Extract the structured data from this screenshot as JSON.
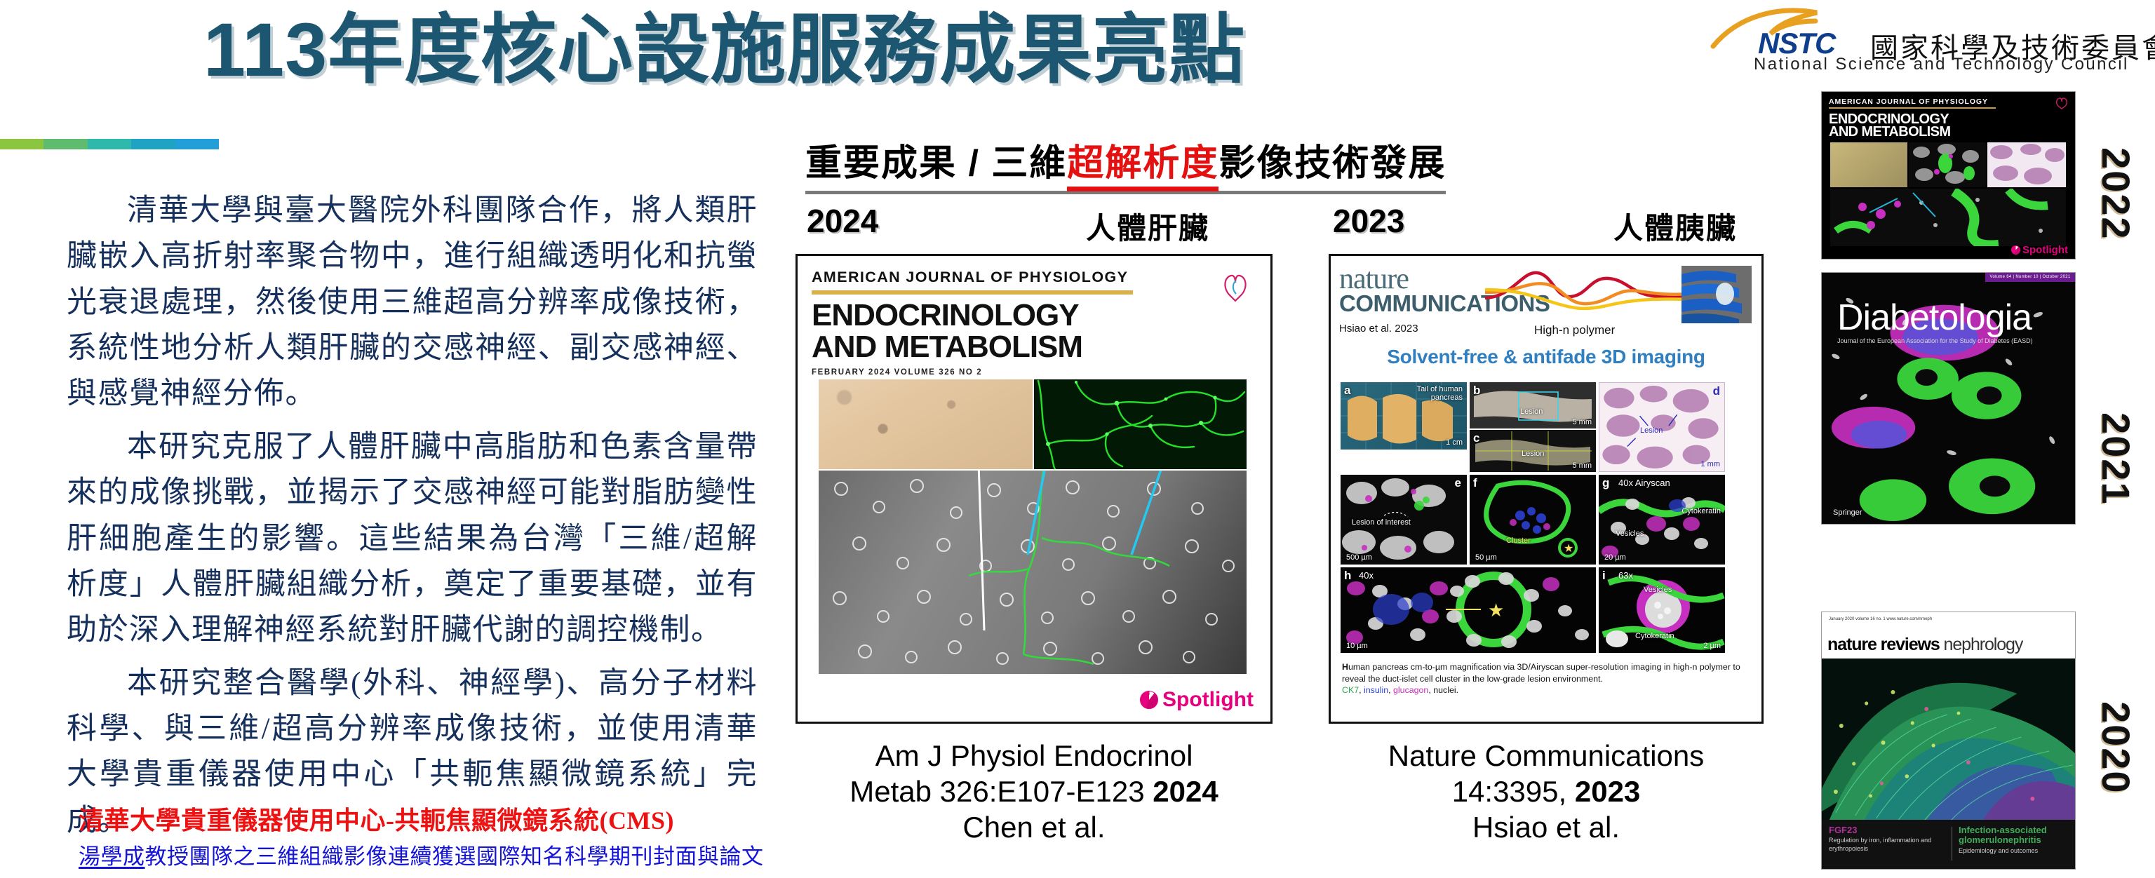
{
  "slide": {
    "title": "113年度核心設施服務成果亮點",
    "title_color": "#1d5670",
    "accent_bar_colors": [
      "#8CC63F",
      "#5FBC6E",
      "#2FB9AD",
      "#1FA3C4",
      "#229FD8"
    ]
  },
  "logo": {
    "acronym": "NSTC",
    "name_cn": "國家科學及技術委員會",
    "name_en": "National Science and Technology Council",
    "swoosh_color": "#E8A020",
    "acronym_color": "#0F3E8C"
  },
  "body": {
    "paragraphs": [
      "清華大學與臺大醫院外科團隊合作，將人類肝臟嵌入高折射率聚合物中，進行組織透明化和抗螢光衰退處理，然後使用三維超高分辨率成像技術，系統性地分析人類肝臟的交感神經、副交感神經、與感覺神經分佈。",
      "本研究克服了人體肝臟中高脂肪和色素含量帶來的成像挑戰，並揭示了交感神經可能對脂肪變性肝細胞產生的影響。這些結果為台灣「三維/超解析度」人體肝臟組織分析，奠定了重要基礎，並有助於深入理解神經系統對肝臟代謝的調控機制。",
      "本研究整合醫學(外科、神經學)、高分子材料科學、與三維/超高分辨率成像技術，並使用清華大學貴重儀器使用中心「共軛焦顯微鏡系統」完成。"
    ],
    "text_color": "#15305C"
  },
  "credits": {
    "line_red": "清華大學貴重儀器使用中心-共軛焦顯微鏡系統(CMS)",
    "line_red_color": "#EE1111",
    "line_blue_underlined": "湯學成",
    "line_blue_rest": "教授團隊之三維組織影像連續獲選國際知名科學期刊封面與論文",
    "line_blue_color": "#1414D8"
  },
  "section": {
    "header_pre": "重要成果 / 三維",
    "header_highlight": "超解析度",
    "header_post": "影像技術發展",
    "highlight_color": "#E41111"
  },
  "highlights": [
    {
      "year": "2024",
      "organ": "人體肝臟",
      "citation_line1": "Am J Physiol Endocrinol",
      "citation_line2_pre": "Metab 326:E107-E123 ",
      "citation_line2_bold": "2024",
      "citation_line3": "Chen et al."
    },
    {
      "year": "2023",
      "organ": "人體胰臟",
      "citation_line1": "Nature Communications",
      "citation_line2_pre": "14:3395, ",
      "citation_line2_bold": "2023",
      "citation_line3": "Hsiao et al."
    }
  ],
  "cover_ajp": {
    "kicker": "AMERICAN JOURNAL OF PHYSIOLOGY",
    "title_line1": "ENDOCRINOLOGY",
    "title_line2": "AND METABOLISM",
    "issue": "FEBRUARY 2024     VOLUME 326     NO 2",
    "badge": "Spotlight",
    "rule_color": "#D8B14A",
    "badge_color": "#E6007E"
  },
  "cover_natcom": {
    "brand_line1": "nature",
    "brand_line2": "COMMUNICATIONS",
    "author_note": "Hsiao et al. 2023",
    "polymer_label": "High-n polymer",
    "tagline": "Solvent-free & antifade 3D imaging",
    "panels": [
      {
        "tag": "a",
        "note": "Tail of human pancreas",
        "scale": "1 cm"
      },
      {
        "tag": "b",
        "note": "Lesion",
        "scale": "5 mm"
      },
      {
        "tag": "c",
        "note": "Lesion",
        "scale": "5 mm"
      },
      {
        "tag": "d",
        "note": "Lesion",
        "scale": "1 mm"
      },
      {
        "tag": "e",
        "note": "Lesion of interest",
        "scale": "500 µm"
      },
      {
        "tag": "f",
        "note": "Cluster",
        "scale": "50 µm"
      },
      {
        "tag": "g",
        "note": "40x Airyscan",
        "scale": "20 µm"
      },
      {
        "tag": "h",
        "note": "40x",
        "scale": "10 µm"
      },
      {
        "tag": "i",
        "note": "63x",
        "scale": "2 µm"
      }
    ],
    "panel_g_labels": [
      "Cytokeratin",
      "Vesicles"
    ],
    "panel_i_labels": [
      "Vesicles",
      "Cytokeratin"
    ],
    "caption_bold": "H",
    "caption_main": "uman pancreas cm-to-µm magnification via 3D/Airyscan super-resolution imaging in high-n polymer to reveal the duct-islet cell cluster in the low-grade lesion environment.",
    "caption_ck7": "CK7",
    "caption_insulin": "insulin",
    "caption_glucagon": "glucagon",
    "caption_nuclei": "nuclei."
  },
  "rail": [
    {
      "year": "2022",
      "journal_kicker": "AMERICAN JOURNAL OF PHYSIOLOGY",
      "journal_title_1": "ENDOCRINOLOGY",
      "journal_title_2": "AND METABOLISM",
      "badge": "Spotlight"
    },
    {
      "year": "2021",
      "journal_title": "Diabetologia",
      "journal_subtitle": "Journal of the European Association for the Study of Diabetes (EASD)",
      "band_text": "Volume 64 | Number 10 | October 2021",
      "publisher": "Springer"
    },
    {
      "year": "2020",
      "journal_title_bold": "nature reviews",
      "journal_title_light": "nephrology",
      "meta": "January 2020 volume 16 no. 1\nwww.nature.com/nrneph",
      "foot1_head": "FGF23",
      "foot1_sub": "Regulation by iron, inflammation and erythropoiesis",
      "foot2_head": "Infection-associated glomerulonephritis",
      "foot2_sub": "Epidemiology and outcomes"
    }
  ]
}
